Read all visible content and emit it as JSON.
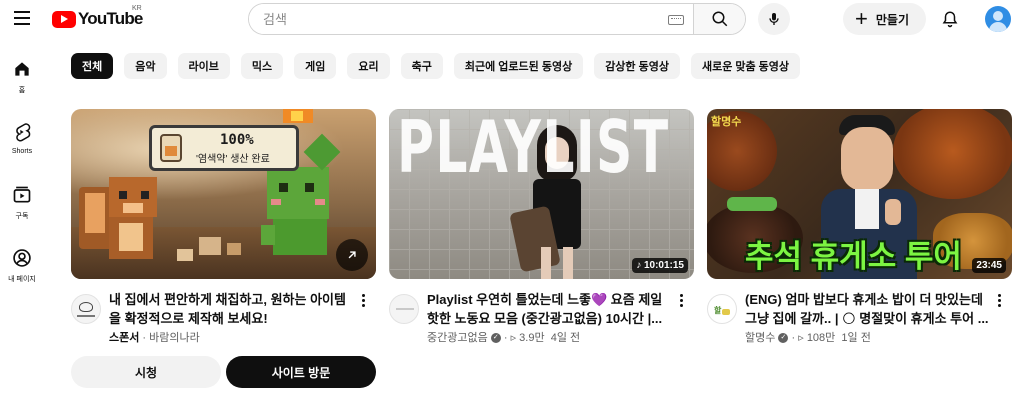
{
  "header": {
    "logo_text": "YouTube",
    "region": "KR",
    "search_placeholder": "검색",
    "create_label": "만들기"
  },
  "sidebar": {
    "items": [
      {
        "label": "홈",
        "icon": "home-icon"
      },
      {
        "label": "Shorts",
        "icon": "shorts-icon"
      },
      {
        "label": "구독",
        "icon": "subscriptions-icon"
      },
      {
        "label": "내 페이지",
        "icon": "account-icon"
      }
    ]
  },
  "chips": [
    "전체",
    "음악",
    "라이브",
    "믹스",
    "게임",
    "요리",
    "축구",
    "최근에 업로드된 동영상",
    "감상한 동영상",
    "새로운 맞춤 동영상"
  ],
  "ad": {
    "badge_count": "100%",
    "badge_text": "'염색약' 생산 완료",
    "title_line1": "내 집에서 편안하게 채집하고, 원하는 아이템",
    "title_line2": "을 확정적으로 제작해 보세요!",
    "sponsor_label": "스폰서",
    "advertiser": "바람의나라",
    "watch_label": "시청",
    "visit_label": "사이트 방문"
  },
  "videos": [
    {
      "thumb_text": "PLAYLIST",
      "duration": "10:01:15",
      "title_line1": "Playlist 우연히 틀었는데 느좋💜 요즘 제일",
      "title_line2": "핫한 노동요 모음 (중간광고없음) 10시간 |...",
      "channel": "중간광고없음",
      "views": "3.9만",
      "age": "4일 전"
    },
    {
      "thumb_text": "추석 휴게소 투어",
      "thumb_logo": "할명수",
      "duration": "23:45",
      "title_line1": "(ENG) 엄마 밥보다 휴게소 밥이 더 맛있는데",
      "title_line2": "그냥 집에 갈까.. | 🌕 명절맞이 휴게소 투어 ...",
      "channel": "할명수",
      "views": "108만",
      "age": "1일 전"
    }
  ],
  "colors": {
    "brand_red": "#ff0000",
    "chip_bg": "#f2f2f2",
    "chip_active": "#0f0f0f",
    "muted_text": "#606060",
    "thumb_green_text": "#7cf542"
  }
}
